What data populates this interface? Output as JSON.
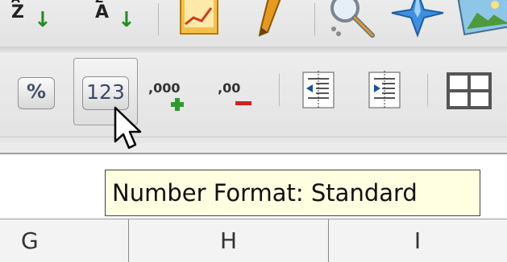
{
  "toolbar_top": {
    "sort_descending": {
      "icon": "sort-descending-icon",
      "glyph_top": "Z",
      "accent": "#1e8f1e"
    },
    "sort_ascending": {
      "icon": "sort-ascending-icon",
      "glyph_top": "A",
      "accent": "#1e8f1e"
    },
    "chart_icon": "chart-icon",
    "draw_icon": "draw-functions-icon",
    "find_icon": "find-replace-icon",
    "navigator_icon": "navigator-icon",
    "gallery_icon": "gallery-icon"
  },
  "toolbar_format": {
    "percent_label": "%",
    "standard_label": "123",
    "add_decimal_label": ",000",
    "delete_decimal_label": ",00",
    "add_color": "#2e9a2e",
    "delete_color": "#cc2222"
  },
  "tooltip": {
    "text": "Number Format: Standard"
  },
  "columns": [
    "G",
    "H",
    "I"
  ]
}
